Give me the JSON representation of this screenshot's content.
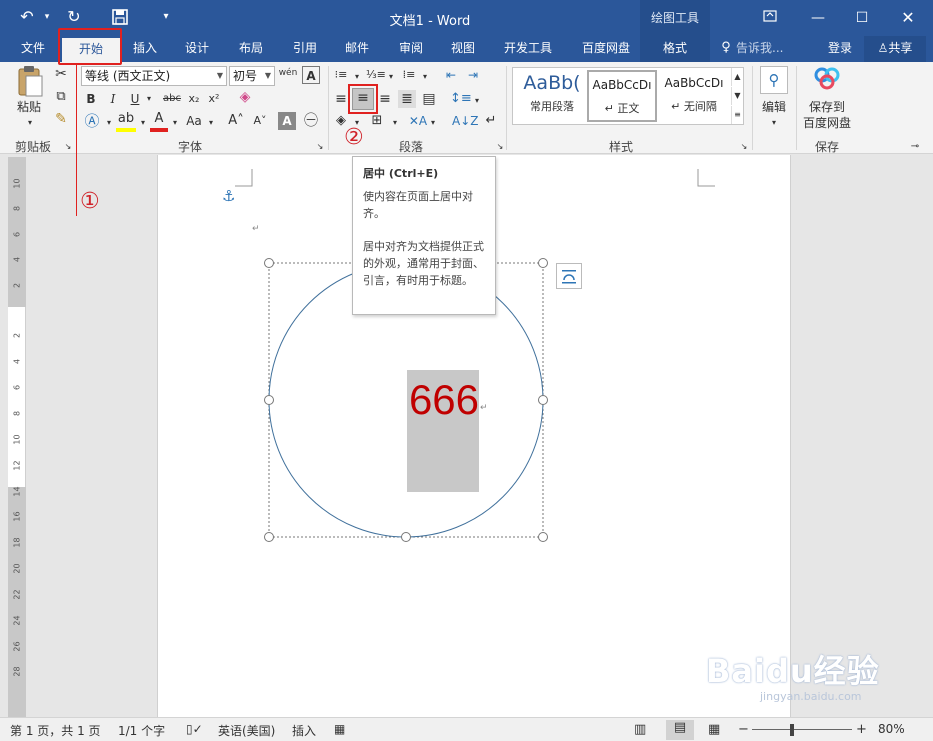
{
  "titlebar": {
    "title": "文档1 - Word",
    "context_tools": "绘图工具",
    "undo_icon": "undo-icon",
    "redo_icon": "redo-icon",
    "save_icon": "save-icon"
  },
  "tabs": [
    {
      "label": "文件"
    },
    {
      "label": "开始"
    },
    {
      "label": "插入"
    },
    {
      "label": "设计"
    },
    {
      "label": "布局"
    },
    {
      "label": "引用"
    },
    {
      "label": "邮件"
    },
    {
      "label": "审阅"
    },
    {
      "label": "视图"
    },
    {
      "label": "开发工具"
    },
    {
      "label": "百度网盘"
    },
    {
      "label": "格式"
    }
  ],
  "tellme": "告诉我...",
  "login": "登录",
  "share": "共享",
  "ribbon": {
    "paste": "粘贴",
    "font_name": "等线 (西文正文)",
    "font_size": "初号",
    "groups": {
      "clipboard": "剪贴板",
      "font": "字体",
      "paragraph": "段落",
      "styles": "样式",
      "save": "保存"
    },
    "styles": [
      {
        "sample": "AaBb(",
        "label": "常用段落"
      },
      {
        "sample": "AaBbCcDı",
        "label": "↵ 正文"
      },
      {
        "sample": "AaBbCcDı",
        "label": "↵ 无间隔"
      }
    ],
    "edit": "编辑",
    "baidu_save_1": "保存到",
    "baidu_save_2": "百度网盘",
    "phonetic": "wén"
  },
  "tooltip": {
    "title": "居中 (Ctrl+E)",
    "line1": "使内容在页面上居中对齐。",
    "line2": "居中对齐为文档提供正式的外观，通常用于封面、引言，有时用于标题。"
  },
  "callouts": {
    "one": "①",
    "two": "②"
  },
  "document": {
    "text": "666",
    "text_color": "#c00000",
    "highlight": "#c8c8c8"
  },
  "ruler_numbers": [
    "10",
    "8",
    "6",
    "4",
    "2",
    "2",
    "4",
    "6",
    "8",
    "10",
    "12",
    "14",
    "16",
    "18",
    "20",
    "22",
    "24",
    "26",
    "28"
  ],
  "statusbar": {
    "page": "第 1 页，共 1 页",
    "words": "1/1 个字",
    "lang": "英语(美国)",
    "insert": "插入",
    "zoom": "80%"
  },
  "watermark": {
    "brand": "Baidu经验",
    "sub": "jingyan.baidu.com"
  },
  "colors": {
    "accent": "#2b579a",
    "callout": "#e0211f"
  }
}
